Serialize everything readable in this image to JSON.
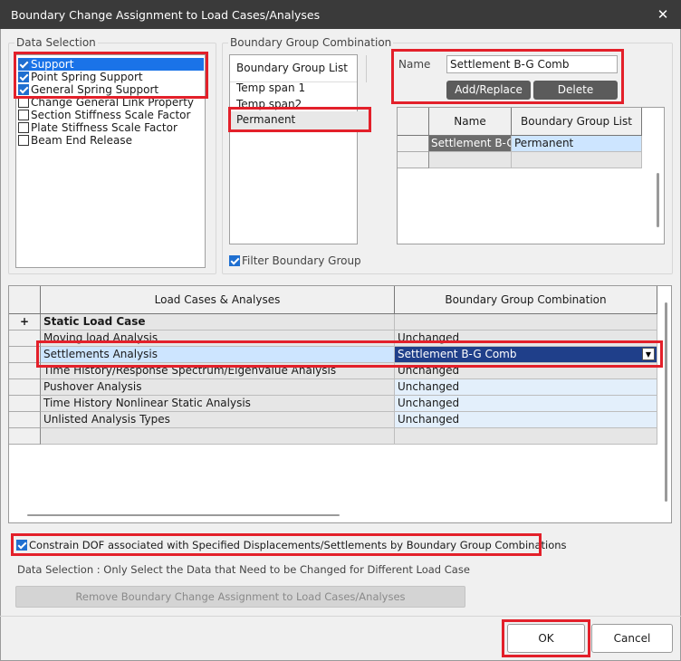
{
  "window": {
    "title": "Boundary Change Assignment to Load Cases/Analyses",
    "close_glyph": "✕"
  },
  "data_selection": {
    "legend": "Data Selection",
    "items": [
      {
        "label": "Support",
        "checked": true,
        "selected": true
      },
      {
        "label": "Point Spring Support",
        "checked": true,
        "selected": false
      },
      {
        "label": "General Spring Support",
        "checked": true,
        "selected": false
      },
      {
        "label": "Change General Link Property",
        "checked": false,
        "selected": false
      },
      {
        "label": "Section Stiffness Scale Factor",
        "checked": false,
        "selected": false
      },
      {
        "label": "Plate Stiffness Scale Factor",
        "checked": false,
        "selected": false
      },
      {
        "label": "Beam End Release",
        "checked": false,
        "selected": false
      }
    ]
  },
  "bgc": {
    "legend": "Boundary Group Combination",
    "list_header": "Boundary Group List",
    "list_items": [
      "Temp span 1",
      "Temp span2",
      "Permanent"
    ],
    "name_label": "Name",
    "name_value": "Settlement B-G Comb",
    "add_replace_label": "Add/Replace",
    "delete_label": "Delete",
    "filter_label": "Filter Boundary Group",
    "filter_checked": true,
    "table": {
      "col_name": "Name",
      "col_list": "Boundary Group List",
      "rows": [
        {
          "name": "Settlement B-G Comb",
          "list": "Permanent"
        }
      ]
    }
  },
  "load_grid": {
    "col1": "Load Cases & Analyses",
    "col2": "Boundary Group Combination",
    "expand_glyph": "+",
    "rows": [
      {
        "case": "Static Load Case",
        "value": "",
        "bold": true
      },
      {
        "case": "Moving load Analysis",
        "value": "Unchanged"
      },
      {
        "case": "Settlements Analysis",
        "value": "Settlement B-G Comb",
        "selected": true
      },
      {
        "case": "Time History/Response Spectrum/Eigenvalue Analysis",
        "value": "Unchanged"
      },
      {
        "case": "Pushover Analysis",
        "value": "Unchanged"
      },
      {
        "case": "Time History Nonlinear Static Analysis",
        "value": "Unchanged"
      },
      {
        "case": "Unlisted Analysis Types",
        "value": "Unchanged"
      }
    ],
    "dropdown_glyph": "▼"
  },
  "constrain": {
    "label": "Constrain DOF associated with Specified Displacements/Settlements by Boundary Group Combinations",
    "checked": true
  },
  "info_text": "Data Selection : Only Select the Data that Need to be Changed for Different Load Case",
  "remove_label": "Remove Boundary Change Assignment to Load Cases/Analyses",
  "ok_label": "OK",
  "cancel_label": "Cancel",
  "colors": {
    "accent": "#1a73e8",
    "highlight_red": "#e3202a",
    "dropdown_bg": "#1f3f8a",
    "selected_row": "#cde5ff"
  }
}
